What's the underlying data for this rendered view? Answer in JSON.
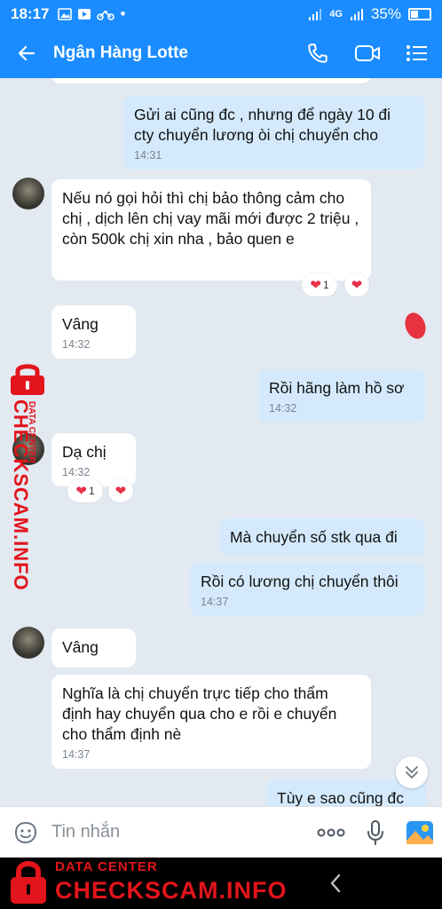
{
  "status_bar": {
    "time": "18:17",
    "network": "4G",
    "battery": "35%"
  },
  "header": {
    "title": "Ngân Hàng Lotte"
  },
  "messages": [
    {
      "text": "Gửi ai cũng đc , nhưng để ngày 10 đi cty chuyển lương òi chị chuyển cho",
      "time": "14:31"
    },
    {
      "text": "Nếu nó gọi hỏi thì chị bảo thông cảm cho chị , dịch lên chị vay mãi mới được 2 triệu , còn 500k chị xin nha , bảo quen e"
    },
    {
      "text": "Vâng",
      "time": "14:32"
    },
    {
      "text": "Rồi hãng làm hồ sơ",
      "time": "14:32"
    },
    {
      "text": "Dạ chị",
      "time": "14:32"
    },
    {
      "text": "Mà chuyển số stk qua đi"
    },
    {
      "text": "Rồi có lương chị chuyển thôi",
      "time": "14:37"
    },
    {
      "text": "Vâng"
    },
    {
      "text": "Nghĩa là chị chuyển trực tiếp cho thẩm định hay chuyển qua cho e rồi e chuyển cho thẩm định nè",
      "time": "14:37"
    },
    {
      "text": "Tùy e sao cũng đc"
    }
  ],
  "reactions": {
    "count_1": "1",
    "count_2": "1"
  },
  "input": {
    "placeholder": "Tin nhắn"
  },
  "watermark": {
    "small": "DATA CENTER",
    "big": "CHECKSCAM.INFO"
  },
  "colors": {
    "header": "#1a8cff",
    "outgoing": "#d4eafc",
    "incoming": "#ffffff",
    "background": "#e2e9f1",
    "watermark": "#e3141b"
  },
  "icons": [
    "back-arrow-icon",
    "phone-icon",
    "video-call-icon",
    "menu-list-icon",
    "sticker-icon",
    "more-icon",
    "mic-icon",
    "image-icon",
    "chevron-double-down-icon",
    "heart-icon",
    "lock-icon"
  ]
}
